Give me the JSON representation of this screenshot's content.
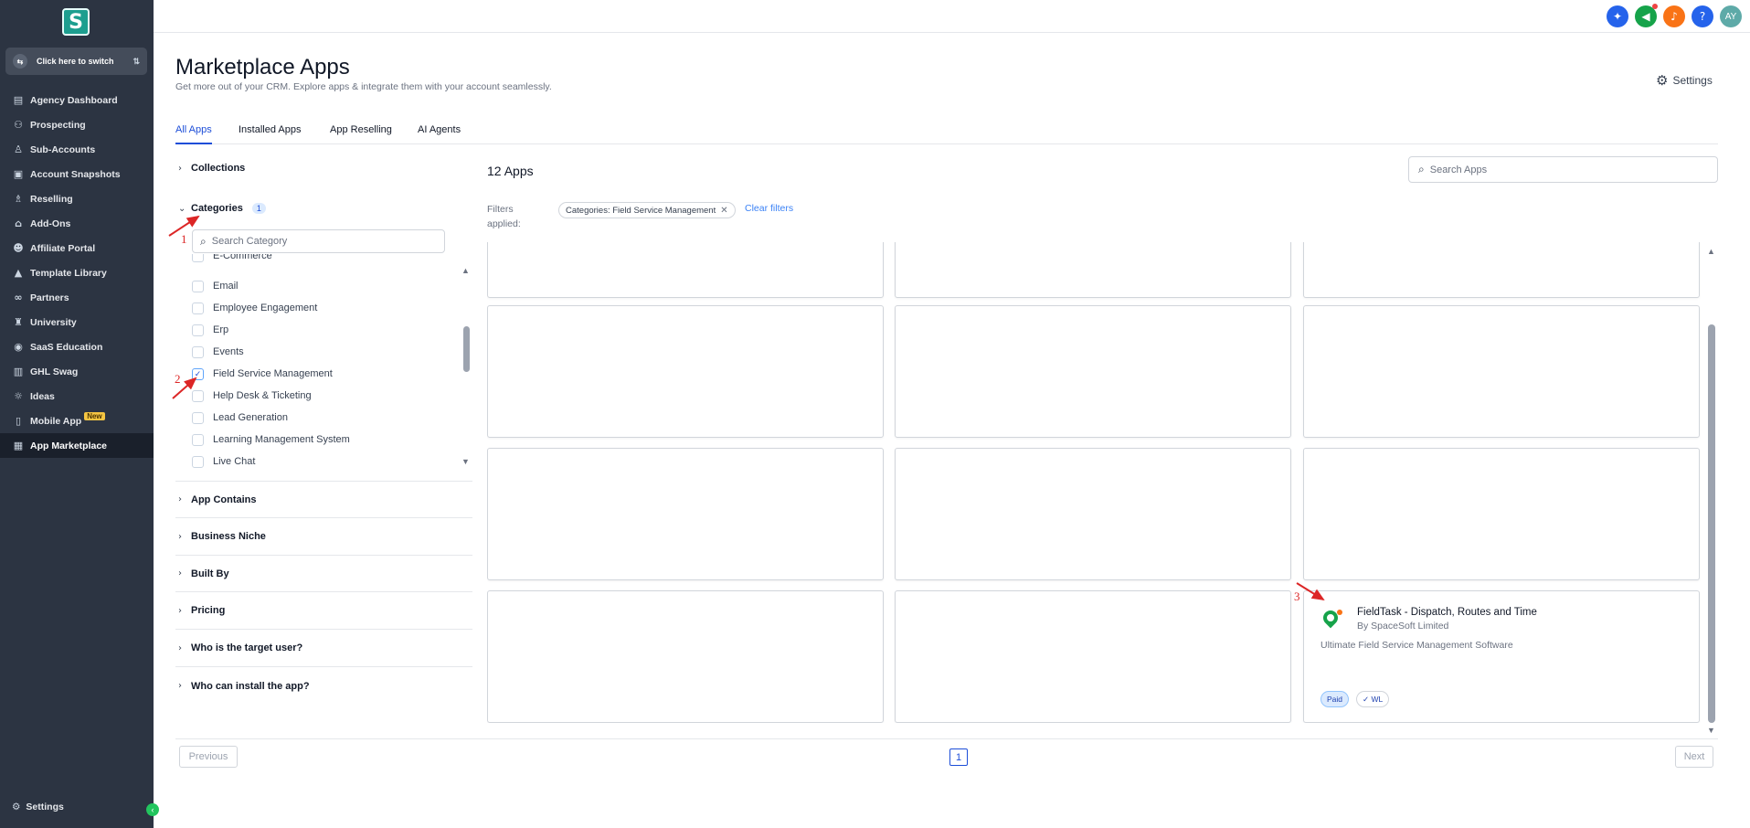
{
  "sidebar": {
    "logo_letter": "S",
    "switcher_label": "Click here to switch",
    "items": [
      {
        "label": "Agency Dashboard",
        "icon": "dashboard-icon"
      },
      {
        "label": "Prospecting",
        "icon": "people-icon"
      },
      {
        "label": "Sub-Accounts",
        "icon": "user-icon"
      },
      {
        "label": "Account Snapshots",
        "icon": "snapshot-icon"
      },
      {
        "label": "Reselling",
        "icon": "reselling-icon"
      },
      {
        "label": "Add-Ons",
        "icon": "bag-icon"
      },
      {
        "label": "Affiliate Portal",
        "icon": "group-icon"
      },
      {
        "label": "Template Library",
        "icon": "template-icon"
      },
      {
        "label": "Partners",
        "icon": "handshake-icon"
      },
      {
        "label": "University",
        "icon": "graduation-icon"
      },
      {
        "label": "SaaS Education",
        "icon": "education-icon"
      },
      {
        "label": "GHL Swag",
        "icon": "store-icon"
      },
      {
        "label": "Ideas",
        "icon": "bulb-icon"
      },
      {
        "label": "Mobile App",
        "icon": "mobile-icon",
        "badge": "New"
      },
      {
        "label": "App Marketplace",
        "icon": "grid-icon",
        "active": true
      }
    ],
    "settings_label": "Settings"
  },
  "topbar": {
    "avatar_initials": "AY",
    "icons": [
      "magic-icon",
      "megaphone-icon",
      "bell-icon",
      "help-icon"
    ]
  },
  "header": {
    "title": "Marketplace Apps",
    "subtitle": "Get more out of your CRM. Explore apps & integrate them with your account seamlessly.",
    "settings_label": "Settings"
  },
  "tabs": [
    {
      "label": "All Apps",
      "active": true
    },
    {
      "label": "Installed Apps"
    },
    {
      "label": "App Reselling"
    },
    {
      "label": "AI Agents"
    }
  ],
  "filters": {
    "collections": "Collections",
    "categories": "Categories",
    "categories_count": "1",
    "category_search_placeholder": "Search Category",
    "category_items": [
      {
        "label": "E-Commerce",
        "checked": false
      },
      {
        "label": "Email",
        "checked": false
      },
      {
        "label": "Employee Engagement",
        "checked": false
      },
      {
        "label": "Erp",
        "checked": false
      },
      {
        "label": "Events",
        "checked": false
      },
      {
        "label": "Field Service Management",
        "checked": true
      },
      {
        "label": "Help Desk & Ticketing",
        "checked": false
      },
      {
        "label": "Lead Generation",
        "checked": false
      },
      {
        "label": "Learning Management System",
        "checked": false
      },
      {
        "label": "Live Chat",
        "checked": false
      }
    ],
    "sections": [
      "App Contains",
      "Business Niche",
      "Built By",
      "Pricing",
      "Who is the target user?",
      "Who can install the app?"
    ]
  },
  "apps": {
    "count_label": "12 Apps",
    "search_placeholder": "Search Apps",
    "filters_applied_label": "Filters applied:",
    "filter_chip": "Categories: Field Service Management",
    "clear_filters": "Clear filters",
    "featured_card": {
      "name": "FieldTask - Dispatch, Routes and Time",
      "by": "By SpaceSoft Limited",
      "description": "Ultimate Field Service Management Software",
      "tags": [
        "Paid",
        "WL"
      ]
    }
  },
  "pagination": {
    "previous": "Previous",
    "page": "1",
    "next": "Next"
  },
  "annotations": [
    "1",
    "2",
    "3"
  ],
  "colors": {
    "sidebar_bg": "#2c3442",
    "accent": "#1d4ed8",
    "annotation": "#dc2626"
  }
}
